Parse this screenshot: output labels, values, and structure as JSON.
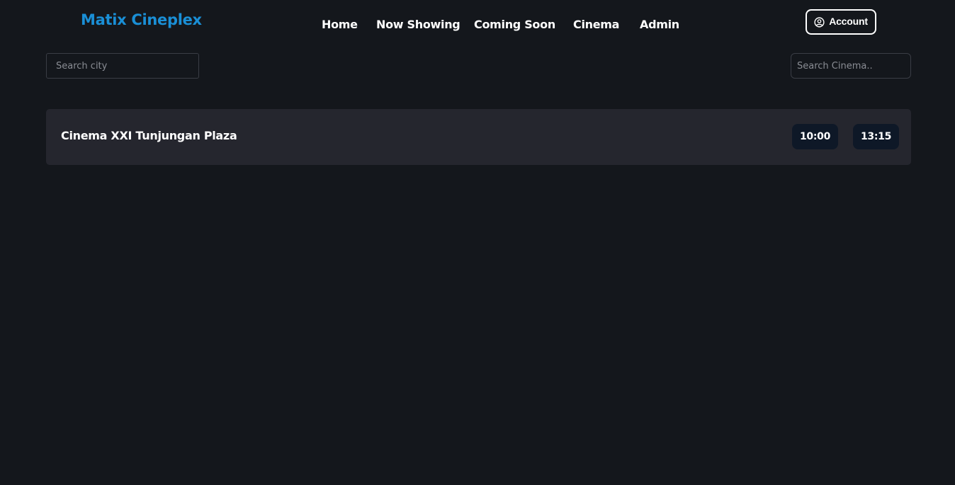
{
  "brand": {
    "title": "Matix Cineplex"
  },
  "nav": {
    "items": [
      "Home",
      "Now Showing",
      "Coming Soon",
      "Cinema",
      "Admin"
    ]
  },
  "account": {
    "label": "Account",
    "icon": "user-circle-icon"
  },
  "search": {
    "city_placeholder": "Search city",
    "city_value": "",
    "cinema_placeholder": "Search Cinema..",
    "cinema_value": ""
  },
  "cinemas": [
    {
      "name": "Cinema XXI Tunjungan Plaza",
      "showtimes": [
        "10:00",
        "13:15"
      ]
    }
  ],
  "colors": {
    "background": "#14171c",
    "brand": "#1a8fd6",
    "card": "#25262e",
    "showtime_bg": "#0e1827"
  }
}
